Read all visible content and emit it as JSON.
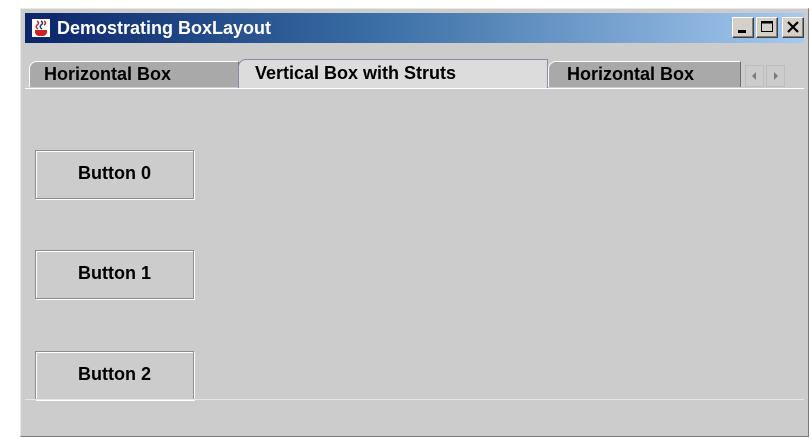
{
  "window": {
    "title": "Demostrating BoxLayout",
    "icon": "java-cup-icon",
    "controls": [
      "minimize-icon",
      "maximize-icon",
      "close-icon"
    ]
  },
  "tabs": [
    {
      "label": "Horizontal Box",
      "selected": false
    },
    {
      "label": "Vertical Box with Struts",
      "selected": true
    },
    {
      "label": "Horizontal Box",
      "selected": false
    }
  ],
  "tab_scroll": {
    "left_icon": "arrow-left-icon",
    "right_icon": "arrow-right-icon"
  },
  "panel": {
    "buttons": [
      {
        "label": "Button 0"
      },
      {
        "label": "Button 1"
      },
      {
        "label": "Button 2"
      }
    ]
  },
  "colors": {
    "title_gradient_start": "#0a246a",
    "title_gradient_end": "#a6caf0",
    "panel_background": "#cccccc"
  }
}
